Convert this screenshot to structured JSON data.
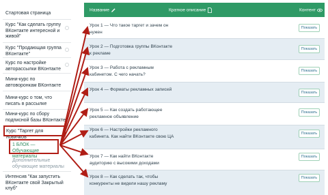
{
  "sidebar": {
    "items": [
      {
        "label": "Стартовая страница"
      },
      {
        "label": "Курс \"Как сделать группу ВКонтакте интересной и живой\""
      },
      {
        "label": "Курс \"Продающая группа ВКонтакте\""
      },
      {
        "label": "Курс по настройке авторассылки ВКонтакте"
      },
      {
        "label": "Мини-курс по автоворонкам ВКонтакте"
      },
      {
        "label": "Мини-курс о том, что писать в рассылке"
      },
      {
        "label": "Мини-курс по сбору подписной базы ВКонтакте"
      },
      {
        "label": "Курс \"Таргет для новичков\""
      },
      {
        "label": "1 БЛОК — Обучающие материалы"
      },
      {
        "label": "Дополнительные обучающие материалы"
      },
      {
        "label": "Интенсив \"Как запустить ВКонтакте свой Закрытый клуб\""
      }
    ]
  },
  "table": {
    "headers": {
      "title": "Название",
      "description": "Краткое описание",
      "content": "Контент"
    },
    "button_label": "Показать",
    "rows": [
      {
        "title": "Урок 1 — Что такое таргет и зачем он нужен"
      },
      {
        "title": "Урок 2 — Подготовка группы ВКонтакте к рекламе"
      },
      {
        "title": "Урок 3 — Работа с рекламным кабинетом. С чего начать?"
      },
      {
        "title": "Урок 4 — Форматы рекламных записей"
      },
      {
        "title": "Урок 5 — Как создать работающее рекламное объявление"
      },
      {
        "title": "Урок 6 — Настройки рекламного кабинета. Как найти ВКонтакте свою ЦА"
      },
      {
        "title": "Урок 7 — Как найти ВКонтакте аудиторию с высокими доходами"
      },
      {
        "title": "Урок 8 — Как сделать так, чтобы конкуренты не видели нашу рекламу"
      }
    ]
  },
  "colors": {
    "header_bg": "#2f9a66",
    "alt_row": "#e5edf3",
    "annotation": "#b01d15",
    "button_border": "#9fd1b7"
  },
  "icons": {
    "title_header": "pencil-icon",
    "description_header": "document-icon",
    "content_header": "eye-icon"
  }
}
